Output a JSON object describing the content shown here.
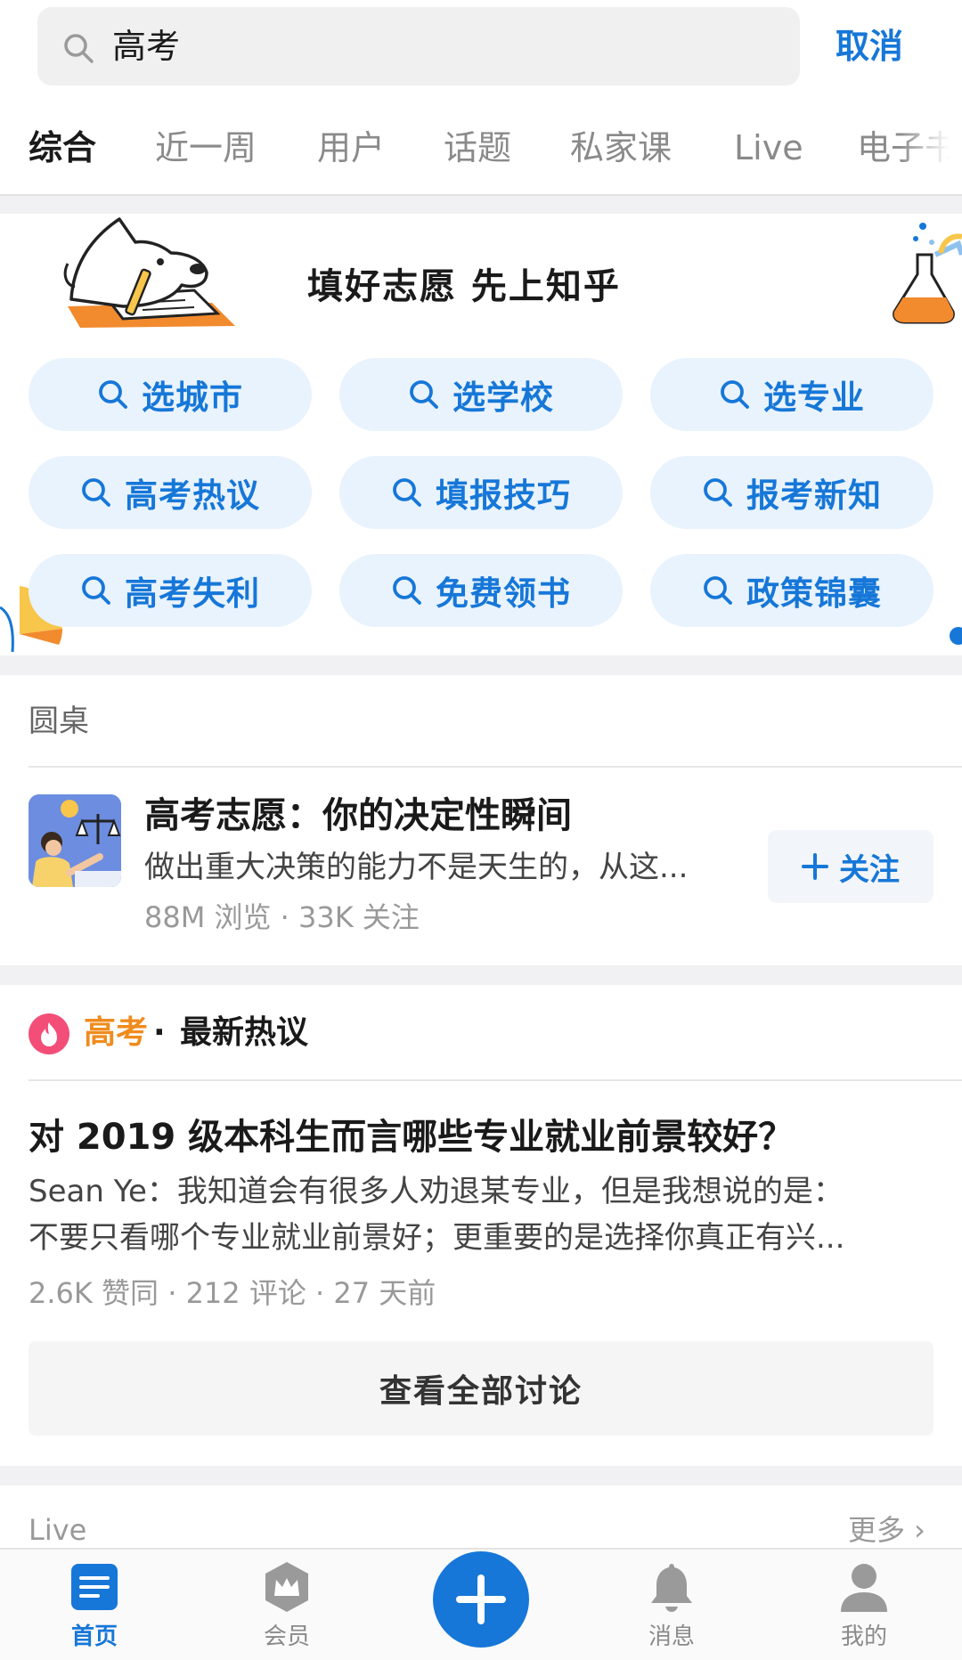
{
  "search": {
    "query": "高考",
    "cancel_label": "取消"
  },
  "tabs": [
    {
      "label": "综合",
      "active": true
    },
    {
      "label": "近一周",
      "active": false
    },
    {
      "label": "用户",
      "active": false
    },
    {
      "label": "话题",
      "active": false
    },
    {
      "label": "私家课",
      "active": false
    },
    {
      "label": "Live",
      "active": false
    },
    {
      "label": "电子书",
      "active": false
    }
  ],
  "banner": {
    "title": "填好志愿 先上知乎",
    "buttons": [
      {
        "label": "选城市"
      },
      {
        "label": "选学校"
      },
      {
        "label": "选专业"
      },
      {
        "label": "高考热议"
      },
      {
        "label": "填报技巧"
      },
      {
        "label": "报考新知"
      },
      {
        "label": "高考失利"
      },
      {
        "label": "免费领书"
      },
      {
        "label": "政策锦囊"
      }
    ]
  },
  "roundtable": {
    "section_label": "圆桌",
    "title": "高考志愿：你的决定性瞬间",
    "description": "做出重大决策的能力不是天生的，从这...",
    "stats": "88M 浏览 · 33K 关注",
    "follow_label": "关注"
  },
  "hot": {
    "topic": "高考",
    "separator": "·",
    "title": "最新热议",
    "question": {
      "title": "对 2019 级本科生而言哪些专业就业前景较好？",
      "excerpt_line1": "Sean Ye：我知道会有很多人劝退某专业，但是我想说的是：",
      "excerpt_line2": "不要只看哪个专业就业前景好；更重要的是选择你真正有兴...",
      "stats": "2.6K 赞同 · 212 评论 · 27 天前"
    },
    "view_all_label": "查看全部讨论"
  },
  "live": {
    "section_label": "Live",
    "more_label": "更多 ›"
  },
  "bottom_nav": [
    {
      "label": "首页",
      "icon": "home-icon",
      "active": true
    },
    {
      "label": "会员",
      "icon": "vip-icon",
      "active": false
    },
    {
      "label": "消息",
      "icon": "bell-icon",
      "active": false
    },
    {
      "label": "我的",
      "icon": "profile-icon",
      "active": false
    }
  ],
  "colors": {
    "accent": "#1677d8",
    "topic_orange": "#f08b1d",
    "hot_pink": "#f24e78"
  }
}
